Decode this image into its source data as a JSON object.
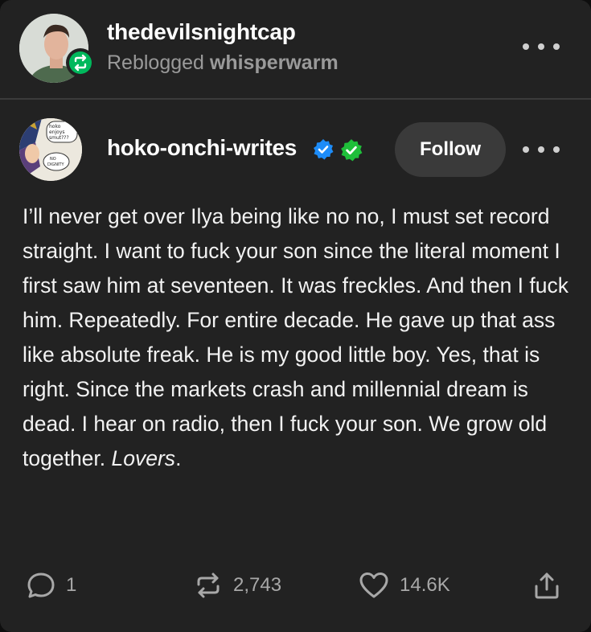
{
  "reblog": {
    "blog_name": "thedevilsnightcap",
    "reblogged_prefix": "Reblogged",
    "reblogged_from": "whisperwarm"
  },
  "post": {
    "blog_name": "hoko-onchi-writes",
    "follow_label": "Follow",
    "avatar_text": [
      "hoko",
      "enjoys",
      "smut???",
      "NO",
      "DIGNITY"
    ],
    "body_main": "I’ll never get over Ilya being like no no, I must set record straight. I want to fuck your son since the literal moment I first saw him at seventeen. It was freckles. And then I fuck him. Repeatedly. For entire decade. He gave up that ass like absolute freak. He is my good little boy. Yes, that is right. Since the markets crash and millennial dream is dead. I hear on radio, then I fuck your son. We grow old together. ",
    "body_italic": "Lovers",
    "body_end": "."
  },
  "footer": {
    "replies": "1",
    "reblogs": "2,743",
    "likes": "14.6K"
  },
  "colors": {
    "card_bg": "#222222",
    "reblog_green": "#00b85c",
    "verified_blue": "#1d8cf8",
    "verified_green": "#1fbf3a",
    "muted_text": "#9a9a9a"
  },
  "icons": [
    "reblog-icon",
    "verified-blue-icon",
    "verified-green-icon",
    "more-icon",
    "reply-icon",
    "reblog-count-icon",
    "heart-icon",
    "share-icon"
  ]
}
